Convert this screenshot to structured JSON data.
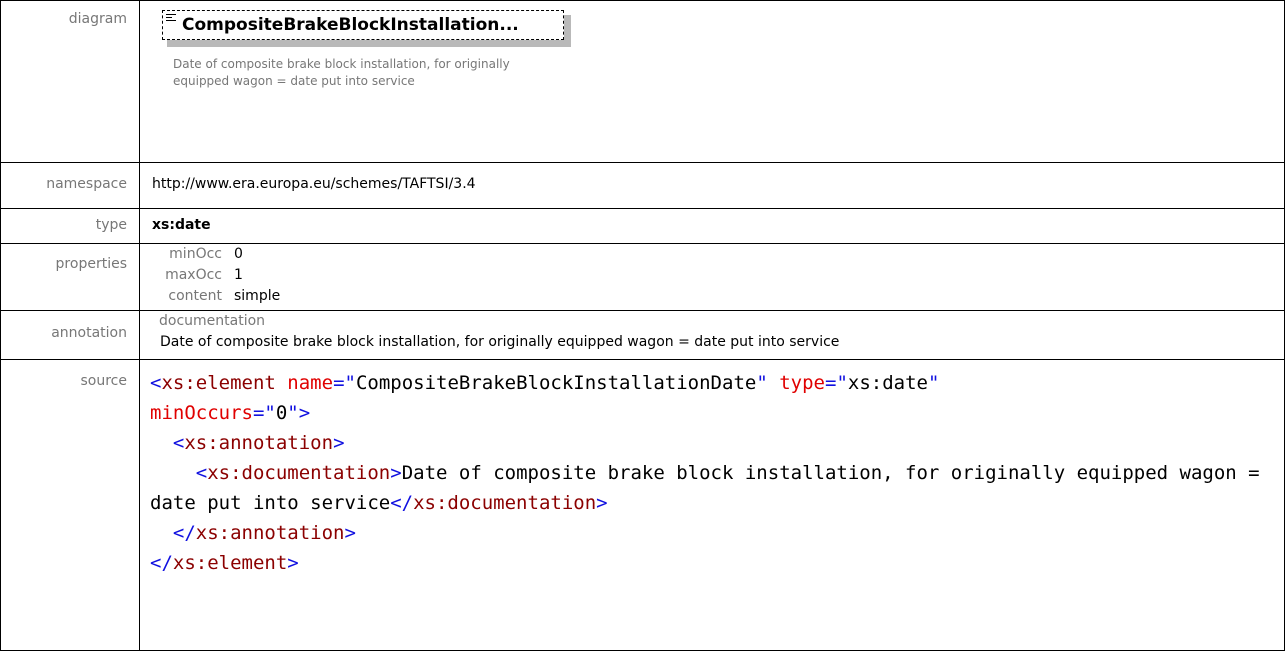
{
  "labels": {
    "diagram": "diagram",
    "namespace": "namespace",
    "type": "type",
    "properties": "properties",
    "annotation": "annotation",
    "source": "source"
  },
  "diagram": {
    "element_name": "CompositeBrakeBlockInstallation...",
    "documentation": "Date of composite brake block installation, for originally equipped wagon = date put into service",
    "icon": "documentation-icon"
  },
  "namespace": "http://www.era.europa.eu/schemes/TAFTSI/3.4",
  "type": "xs:date",
  "properties": [
    {
      "key": "minOcc",
      "value": "0"
    },
    {
      "key": "maxOcc",
      "value": "1"
    },
    {
      "key": "content",
      "value": "simple"
    }
  ],
  "annotation": {
    "key": "documentation",
    "value": "Date of composite brake block installation, for originally equipped wagon = date put into service"
  },
  "source": {
    "open_tag": "xs:element",
    "name_attr": "name",
    "name_val": "CompositeBrakeBlockInstallationDate",
    "type_attr": "type",
    "type_val": "xs:date",
    "min_attr": "minOccurs",
    "min_val": "0",
    "annotation_tag": "xs:annotation",
    "documentation_tag": "xs:documentation",
    "documentation_text": "Date of composite brake block installation, for originally equipped wagon = date put into service"
  },
  "colors": {
    "tag_bracket": "#1010e0",
    "tag_name": "#8b0000",
    "attr_name": "#e00000",
    "label_gray": "#777777"
  }
}
